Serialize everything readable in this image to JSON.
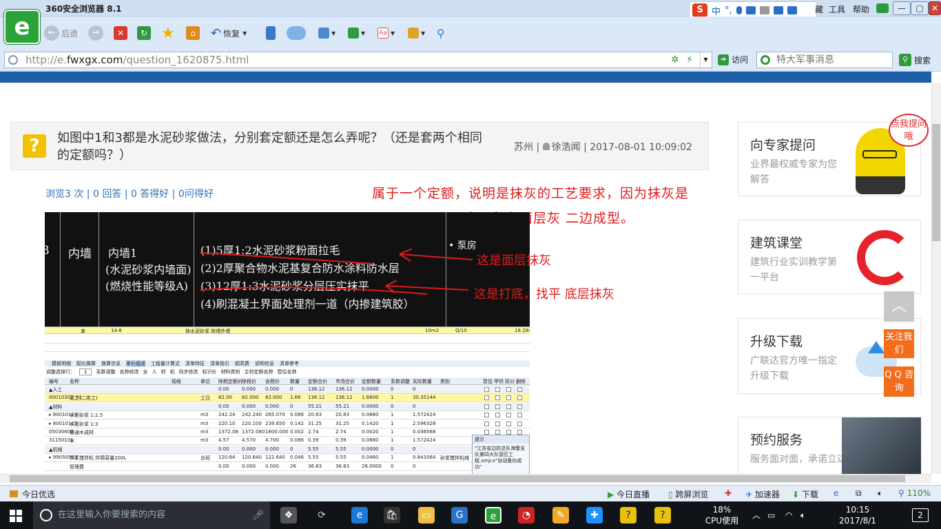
{
  "browser": {
    "title": "360安全浏览器 8.1",
    "logo_letter": "e",
    "menus": [
      "工具",
      "帮助"
    ],
    "menu_partial": "藏",
    "win_min": "—",
    "win_max": "▢",
    "win_close": "✕"
  },
  "ime": {
    "badge": "S",
    "label": "中",
    "punct": "°,"
  },
  "toolbar": {
    "back": "后退",
    "forward_icon": "→",
    "restore": "恢复"
  },
  "address": {
    "url_host": "http://e.",
    "url_domain": "fwxgx.com",
    "url_path": "/question_1620875.html",
    "visit": "访问",
    "search_placeholder": "特大军事消息",
    "search_btn": "搜索"
  },
  "question": {
    "icon": "?",
    "title": "如图中1和3都是水泥砂浆做法，分别套定额还是怎么弄呢？（还是套两个相同的定额吗？）",
    "meta": "苏州 | ",
    "user": "徐浩闻",
    "date": " | 2017-08-01 10:09:02",
    "stats": "浏览3 次 | 0 回答 | 0 答得好 | 0问得好"
  },
  "answer": {
    "line1": "属于一个定额，说明是抹灰的工艺要求，因为抹灰是",
    "line2": "底层灰和面层灰 二边成型。",
    "note1": "这是面层抹灰",
    "note2": "这是打底，找平 底层抹灰"
  },
  "dark_image": {
    "col0": "3",
    "wall": "内墙",
    "name1": "内墙1",
    "name2": "(水泥砂浆内墙面)",
    "name3": "(燃烧性能等级A)",
    "step1": "(1)5厚1:2水泥砂浆粉面拉毛",
    "step2": "(2)2厚聚合物水泥基复合防水涂料防水层",
    "step3": "(3)12厚1:3水泥砂浆分层压实抹平",
    "step4": "(4)刷混凝土界面处理剂一道（内掺建筑胶）",
    "room": "• 泵房"
  },
  "shot": {
    "top_row": [
      "单",
      "14-8",
      "抹水泥砂浆 砖墙外墙",
      "10m2",
      "Q/10",
      "18.284"
    ],
    "tabs": [
      "模板明细",
      "配比换算",
      "换算信息",
      "单价组成",
      "工程量计算式",
      "清单特征",
      "清单指引",
      "超高费",
      "说明信息",
      "清单参考"
    ],
    "opts": [
      "调整选择行：",
      "1",
      "系数调整",
      "名称修改",
      "全",
      "人",
      "材",
      "机",
      "同步修改",
      "标识价",
      "材料类别",
      "主材定额名称",
      "暂估名称"
    ],
    "headers": [
      "编号",
      "名称",
      "规格",
      "单位",
      "除税定额价",
      "除税价",
      "含税价",
      "数量",
      "定额合价",
      "市场合价",
      "定额数量",
      "系数调整",
      "实际数量",
      "类别",
      "暂估",
      "甲供",
      "拆分",
      "删除"
    ],
    "rows": [
      [
        "▲人工",
        "",
        "",
        "",
        "0.00",
        "0.000",
        "0.000",
        "0",
        "136.12",
        "136.12",
        "0.0000",
        "0",
        "0",
        ""
      ],
      [
        "00010302_01",
        "泥工(二类工)",
        "",
        "工日",
        "82.00",
        "82.000",
        "82.000",
        "1.66",
        "136.12",
        "136.12",
        "1.6600",
        "1",
        "30.35144",
        ""
      ],
      [
        "▲材料",
        "",
        "",
        "",
        "0.00",
        "0.000",
        "0.000",
        "0",
        "55.21",
        "55.21",
        "0.0000",
        "0",
        "0",
        ""
      ],
      [
        "▸ 80010124",
        "水泥砂浆 1:2.5",
        "",
        "m3",
        "242.24",
        "242.240",
        "265.070",
        "0.086",
        "20.83",
        "20.83",
        "0.0860",
        "1",
        "1.572424",
        ""
      ],
      [
        "▸ 80010125",
        "水泥砂浆 1:3",
        "",
        "m3",
        "220.10",
        "220.100",
        "239.650",
        "0.142",
        "31.25",
        "31.25",
        "0.1420",
        "1",
        "2.596328",
        ""
      ],
      [
        "05030600",
        "普通木成材",
        "",
        "m3",
        "1372.08",
        "1372.080",
        "1600.000",
        "0.002",
        "2.74",
        "2.74",
        "0.0020",
        "1",
        "0.036568",
        ""
      ],
      [
        "31150101",
        "水",
        "",
        "m3",
        "4.57",
        "4.570",
        "4.700",
        "0.086",
        "0.39",
        "0.39",
        "0.0860",
        "1",
        "1.572424",
        ""
      ],
      [
        "▲机械",
        "",
        "",
        "",
        "0.00",
        "0.000",
        "0.000",
        "0",
        "5.55",
        "5.55",
        "0.0000",
        "0",
        "0",
        ""
      ],
      [
        "▸ 99050503",
        "灰浆搅拌机 拌筒容量200L",
        "",
        "台班",
        "120.64",
        "120.640",
        "122.640",
        "0.046",
        "5.55",
        "5.55",
        "0.0460",
        "1",
        "0.841064",
        "砂浆搅拌机械"
      ],
      [
        "",
        "管理费",
        "",
        "",
        "0.00",
        "0.000",
        "0.000",
        "26",
        "36.83",
        "36.83",
        "26.0000",
        "0",
        "0",
        ""
      ]
    ],
    "popup_title": "提示",
    "popup_text": "\"江苏省边防总队海警支队第四大队营区工程.xmjcx\"自动备份成功\""
  },
  "sidebar": {
    "c1_title": "向专家提问",
    "c1_sub": "业界最权威专家为您解答",
    "bubble": "点我提问哦",
    "c2_title": "建筑课堂",
    "c2_sub": "建筑行业实训教学第一平台",
    "c3_title": "升级下载",
    "c3_sub": "广联达官方唯一指定升级下载",
    "c4_title": "预约服务",
    "c4_sub": "服务面对面，承诺立达",
    "follow": "关注我们",
    "qq": "Q Q 咨询",
    "top_arrow": "︿"
  },
  "statusbar": {
    "left": "今日优选",
    "items": [
      "今日直播",
      "跨屏浏览",
      "加速器",
      "下载"
    ],
    "zoom": "110%"
  },
  "taskbar": {
    "search_placeholder": "在这里输入你要搜索的内容",
    "cpu_pct": "18%",
    "cpu_label": "CPU使用",
    "time": "10:15",
    "date": "2017/8/1",
    "notif": "2"
  },
  "colors": {
    "accent_red": "#e01a1a",
    "link_blue": "#2a6fb6",
    "orange": "#f26e1d",
    "brand_green": "#2aa33b"
  }
}
